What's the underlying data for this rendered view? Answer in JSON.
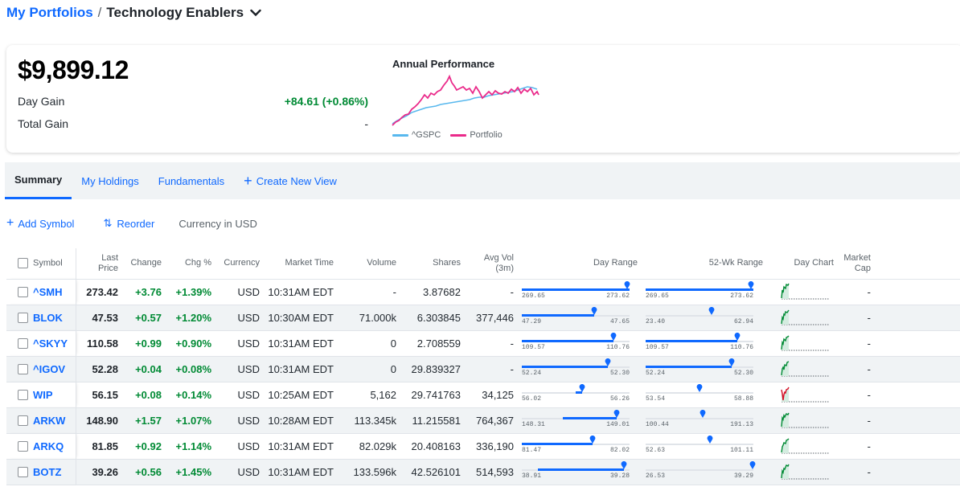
{
  "breadcrumb": {
    "parent": "My Portfolios",
    "separator": "/",
    "current": "Technology Enablers"
  },
  "summary": {
    "total_value": "$9,899.12",
    "day_gain_label": "Day Gain",
    "day_gain_value": "+84.61 (+0.86%)",
    "total_gain_label": "Total Gain",
    "total_gain_value": "-",
    "chart_title": "Annual Performance",
    "legend": [
      {
        "name": "^GSPC",
        "color": "#58b8ee"
      },
      {
        "name": "Portfolio",
        "color": "#ea2a8a"
      }
    ]
  },
  "tabs": [
    {
      "label": "Summary",
      "active": true
    },
    {
      "label": "My Holdings"
    },
    {
      "label": "Fundamentals"
    },
    {
      "label": "Create New View",
      "icon": "plus-icon"
    }
  ],
  "actions": {
    "add_symbol": "Add Symbol",
    "reorder": "Reorder",
    "currency": "Currency in USD"
  },
  "columns": {
    "symbol": "Symbol",
    "last_price": "Last Price",
    "change": "Change",
    "chg_pct": "Chg %",
    "currency": "Currency",
    "market_time": "Market Time",
    "volume": "Volume",
    "shares": "Shares",
    "avg_vol": "Avg Vol (3m)",
    "day_range": "Day Range",
    "wk52_range": "52-Wk Range",
    "day_chart": "Day Chart",
    "market_cap": "Market Cap"
  },
  "colors": {
    "accent": "#0f69ff",
    "positive": "#008a34",
    "negative": "#d60a22",
    "shade": "#f0f3f5"
  },
  "rows": [
    {
      "symbol": "^SMH",
      "price": "273.42",
      "change": "+3.76",
      "pct": "+1.39%",
      "currency": "USD",
      "time": "10:31AM EDT",
      "volume": "-",
      "shares": "3.87682",
      "avg_vol": "-",
      "day_lo": "269.65",
      "day_hi": "273.62",
      "day_fill": [
        0,
        1.0
      ],
      "day_mark": 0.98,
      "wk_lo": "269.65",
      "wk_hi": "273.62",
      "wk_fill": [
        0,
        1.0
      ],
      "wk_mark": 0.98,
      "market_cap": "-"
    },
    {
      "symbol": "BLOK",
      "price": "47.53",
      "change": "+0.57",
      "pct": "+1.20%",
      "currency": "USD",
      "time": "10:30AM EDT",
      "volume": "71.000k",
      "shares": "6.303845",
      "avg_vol": "377,446",
      "day_lo": "47.29",
      "day_hi": "47.65",
      "day_fill": [
        0,
        0.67
      ],
      "day_mark": 0.67,
      "wk_lo": "23.40",
      "wk_hi": "62.94",
      "wk_fill": [
        0,
        0
      ],
      "wk_mark": 0.61,
      "market_cap": "-"
    },
    {
      "symbol": "^SKYY",
      "price": "110.58",
      "change": "+0.99",
      "pct": "+0.90%",
      "currency": "USD",
      "time": "10:31AM EDT",
      "volume": "0",
      "shares": "2.708559",
      "avg_vol": "-",
      "day_lo": "109.57",
      "day_hi": "110.76",
      "day_fill": [
        0,
        0.85
      ],
      "day_mark": 0.85,
      "wk_lo": "109.57",
      "wk_hi": "110.76",
      "wk_fill": [
        0,
        0.85
      ],
      "wk_mark": 0.85,
      "market_cap": "-"
    },
    {
      "symbol": "^IGOV",
      "price": "52.28",
      "change": "+0.04",
      "pct": "+0.08%",
      "currency": "USD",
      "time": "10:31AM EDT",
      "volume": "0",
      "shares": "29.839327",
      "avg_vol": "-",
      "day_lo": "52.24",
      "day_hi": "52.30",
      "day_fill": [
        0,
        0.8
      ],
      "day_mark": 0.8,
      "wk_lo": "52.24",
      "wk_hi": "52.30",
      "wk_fill": [
        0,
        0.8
      ],
      "wk_mark": 0.8,
      "market_cap": "-"
    },
    {
      "symbol": "WIP",
      "price": "56.15",
      "change": "+0.08",
      "pct": "+0.14%",
      "currency": "USD",
      "time": "10:25AM EDT",
      "volume": "5,162",
      "shares": "29.741763",
      "avg_vol": "34,125",
      "day_lo": "56.02",
      "day_hi": "56.26",
      "day_fill": [
        0.5,
        0.56
      ],
      "day_mark": 0.56,
      "wk_lo": "53.54",
      "wk_hi": "58.88",
      "wk_fill": [
        0,
        0
      ],
      "wk_mark": 0.5,
      "market_cap": "-"
    },
    {
      "symbol": "ARKW",
      "price": "148.90",
      "change": "+1.57",
      "pct": "+1.07%",
      "currency": "USD",
      "time": "10:28AM EDT",
      "volume": "113.345k",
      "shares": "11.215581",
      "avg_vol": "764,367",
      "day_lo": "148.31",
      "day_hi": "149.01",
      "day_fill": [
        0.38,
        0.88
      ],
      "day_mark": 0.88,
      "wk_lo": "100.44",
      "wk_hi": "191.13",
      "wk_fill": [
        0,
        0
      ],
      "wk_mark": 0.53,
      "market_cap": "-"
    },
    {
      "symbol": "ARKQ",
      "price": "81.85",
      "change": "+0.92",
      "pct": "+1.14%",
      "currency": "USD",
      "time": "10:31AM EDT",
      "volume": "82.029k",
      "shares": "20.408163",
      "avg_vol": "336,190",
      "day_lo": "81.47",
      "day_hi": "82.02",
      "day_fill": [
        0,
        0.66
      ],
      "day_mark": 0.66,
      "wk_lo": "52.63",
      "wk_hi": "101.11",
      "wk_fill": [
        0,
        0
      ],
      "wk_mark": 0.6,
      "market_cap": "-"
    },
    {
      "symbol": "BOTZ",
      "price": "39.26",
      "change": "+0.56",
      "pct": "+1.45%",
      "currency": "USD",
      "time": "10:31AM EDT",
      "volume": "133.596k",
      "shares": "42.526101",
      "avg_vol": "514,593",
      "day_lo": "38.91",
      "day_hi": "39.28",
      "day_fill": [
        0.15,
        0.95
      ],
      "day_mark": 0.95,
      "wk_lo": "26.53",
      "wk_hi": "39.29",
      "wk_fill": [
        0,
        0
      ],
      "wk_mark": 0.99,
      "market_cap": "-"
    }
  ]
}
